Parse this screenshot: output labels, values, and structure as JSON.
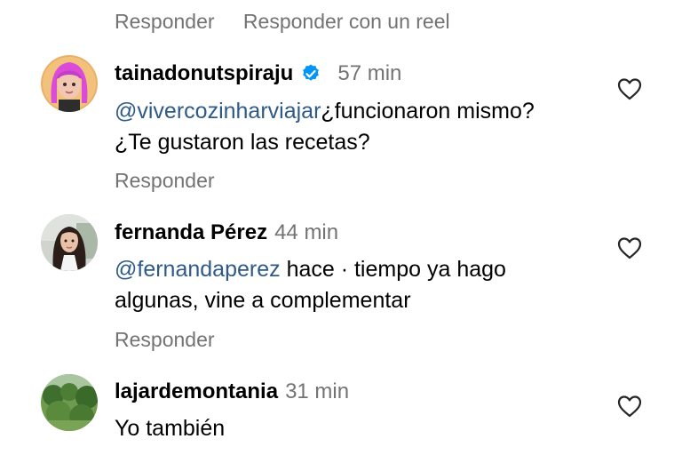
{
  "top_actions": {
    "reply": "Responder",
    "reply_reel": "Responder con un reel"
  },
  "comments": [
    {
      "username": "tainadonutspiraju",
      "verified": true,
      "time": "57 min",
      "mention": "@vivercozinharviajar",
      "text_line1": "¿funcionaron mismo?",
      "text_line2": "¿Te gustaron las recetas?",
      "reply": "Responder"
    },
    {
      "username": "fernanda Pérez",
      "verified": false,
      "time": "44 min",
      "mention": "@fernandaperez",
      "text_line1": "hace · tiempo ya hago",
      "text_line2": "algunas, vine a complementar",
      "reply": "Responder"
    },
    {
      "username": "lajardemontania",
      "verified": false,
      "time": "31 min",
      "text_line1": "Yo también"
    }
  ],
  "colors": {
    "secondary_text": "#737373",
    "mention": "#2e5a8a",
    "verified_badge": "#0095f6"
  },
  "icons": {
    "like": "heart-outline-icon",
    "verified": "verified-badge-icon"
  }
}
